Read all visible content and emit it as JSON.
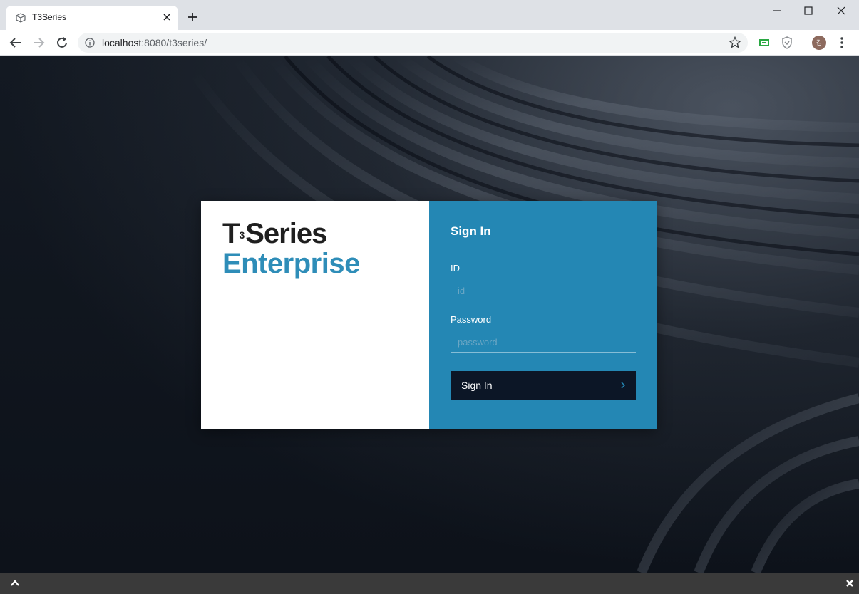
{
  "browser": {
    "tab_title": "T3Series",
    "url_host": "localhost",
    "url_rest": ":8080/t3series/",
    "avatar_letter": "김"
  },
  "login": {
    "logo_main": "Series",
    "logo_t": "T",
    "logo_sup": "3",
    "logo_sub": "Enterprise",
    "title": "Sign In",
    "id_label": "ID",
    "id_placeholder": "id",
    "password_label": "Password",
    "password_placeholder": "password",
    "submit_label": "Sign In"
  },
  "colors": {
    "panel_blue": "#2487b4",
    "button_dark": "#0c1626",
    "logo_blue": "#2e8db8"
  }
}
